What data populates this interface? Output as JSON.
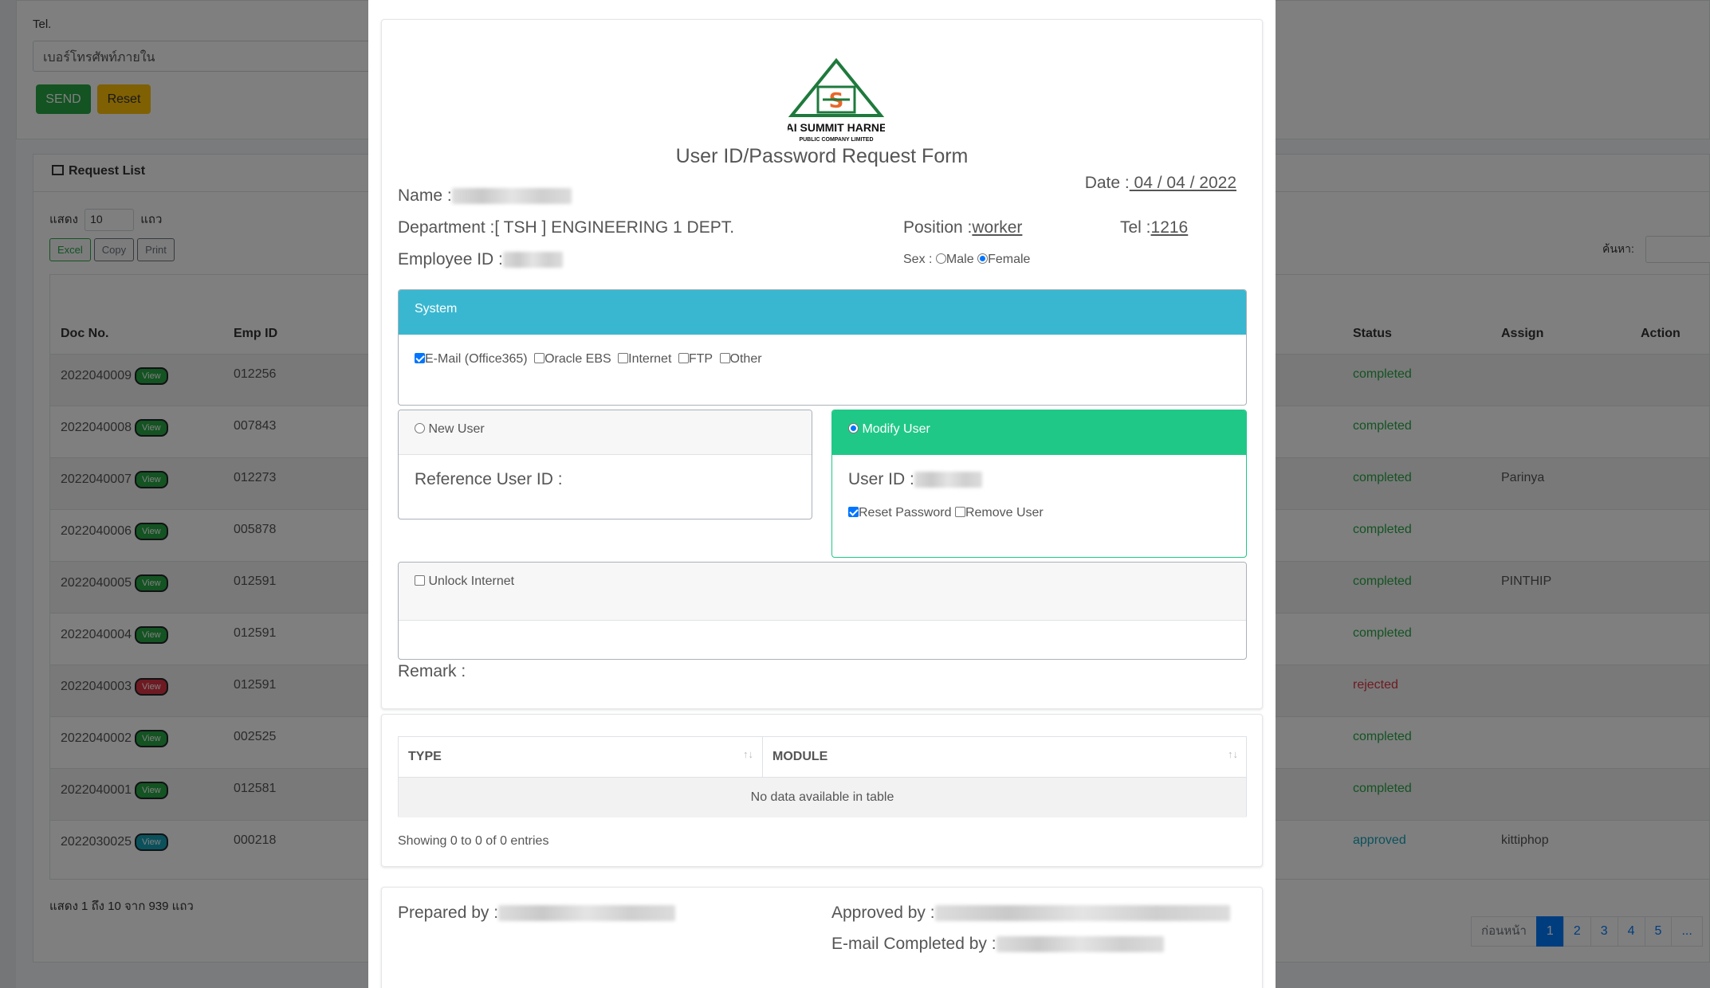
{
  "background": {
    "tel_label": "Tel.",
    "tel_placeholder": "เบอร์โทรศัพท์ภายใน",
    "send_label": "SEND",
    "reset_label": "Reset",
    "request_list_title": "Request List",
    "show_prefix": "แสดง",
    "show_value": "10",
    "show_suffix": "แถว",
    "export_buttons": [
      "Excel",
      "Copy",
      "Print"
    ],
    "search_label": "ค้นหา:",
    "columns": [
      "Doc No.",
      "Emp ID",
      "Status",
      "Assign",
      "Action"
    ],
    "rows": [
      {
        "doc": "2022040009",
        "badge": "View",
        "badge_color": "green",
        "emp": "012256",
        "status": "completed",
        "assign": ""
      },
      {
        "doc": "2022040008",
        "badge": "View",
        "badge_color": "green",
        "emp": "007843",
        "status": "completed",
        "assign": ""
      },
      {
        "doc": "2022040007",
        "badge": "View",
        "badge_color": "green",
        "emp": "012273",
        "status": "completed",
        "assign": "Parinya"
      },
      {
        "doc": "2022040006",
        "badge": "View",
        "badge_color": "green",
        "emp": "005878",
        "status": "completed",
        "assign": ""
      },
      {
        "doc": "2022040005",
        "badge": "View",
        "badge_color": "green",
        "emp": "012591",
        "status": "completed",
        "assign": "PINTHIP"
      },
      {
        "doc": "2022040004",
        "badge": "View",
        "badge_color": "green",
        "emp": "012591",
        "status": "completed",
        "assign": ""
      },
      {
        "doc": "2022040003",
        "badge": "View",
        "badge_color": "red",
        "emp": "012591",
        "status": "rejected",
        "assign": ""
      },
      {
        "doc": "2022040002",
        "badge": "View",
        "badge_color": "green",
        "emp": "002525",
        "status": "completed",
        "assign": ""
      },
      {
        "doc": "2022040001",
        "badge": "View",
        "badge_color": "green",
        "emp": "012581",
        "status": "completed",
        "assign": ""
      },
      {
        "doc": "2022030025",
        "badge": "View",
        "badge_color": "teal",
        "emp": "000218",
        "status": "approved",
        "assign": "kittiphop"
      }
    ],
    "footer_info": "แสดง 1 ถึง 10 จาก 939 แถว",
    "pager": {
      "prev": "ก่อนหน้า",
      "pages": [
        "1",
        "2",
        "3",
        "4",
        "5",
        "..."
      ],
      "active": "1"
    }
  },
  "modal": {
    "logo": {
      "name": "THAI SUMMIT HARNESS",
      "sub": "PUBLIC COMPANY LIMITED",
      "colors": {
        "green": "#1e7a3c",
        "orange": "#e8662a"
      }
    },
    "form_title": "User ID/Password Request Form",
    "date_label": "Date :",
    "date_value": " 04 / 04 / 2022",
    "name_label": "Name :",
    "department_label": "Department :",
    "department_value": "[ TSH ] ENGINEERING 1 DEPT.",
    "position_label": "Position :",
    "position_value": "worker",
    "tel_label": "Tel :",
    "tel_value": "1216",
    "employee_id_label": "Employee ID :",
    "sex_label": "Sex :",
    "sex_male": "Male",
    "sex_female": "Female",
    "sex_selected": "Female",
    "system": {
      "title": "System",
      "options": [
        {
          "label": "E-Mail (Office365)",
          "checked": true
        },
        {
          "label": "Oracle EBS",
          "checked": false
        },
        {
          "label": "Internet",
          "checked": false
        },
        {
          "label": "FTP",
          "checked": false
        },
        {
          "label": "Other",
          "checked": false
        }
      ]
    },
    "new_user": {
      "label": "New User",
      "reference_label": "Reference User ID :"
    },
    "modify_user": {
      "label": "Modify User",
      "user_id_label": "User ID :",
      "reset_password": "Reset Password",
      "remove_user": "Remove User"
    },
    "unlock_internet": "Unlock Internet",
    "remark_label": "Remark :",
    "table": {
      "col_type": "TYPE",
      "col_module": "MODULE",
      "empty": "No data available in table",
      "showing": "Showing 0 to 0 of 0 entries"
    },
    "prepared_by_label": "Prepared by :",
    "approved_by_label": "Approved by :",
    "email_completed_label": "E-mail Completed by :"
  }
}
